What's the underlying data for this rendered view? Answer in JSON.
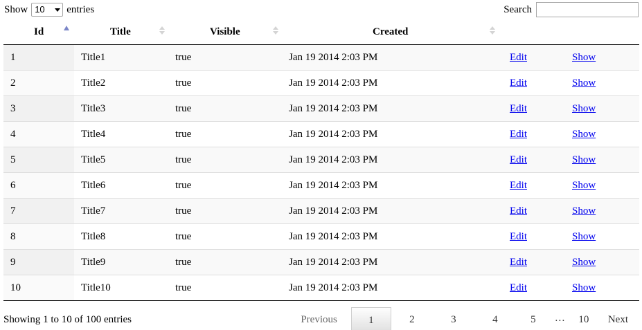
{
  "length_control": {
    "show_label": "Show",
    "selected": "10",
    "entries_label": "entries"
  },
  "search": {
    "label": "Search",
    "value": ""
  },
  "table": {
    "headers": {
      "id": "Id",
      "title": "Title",
      "visible": "Visible",
      "created": "Created"
    },
    "sorted_column": "id",
    "sort_direction": "ascending",
    "rows": [
      {
        "id": "1",
        "title": "Title1",
        "visible": "true",
        "created": "Jan 19 2014 2:03 PM",
        "edit": "Edit",
        "show": "Show"
      },
      {
        "id": "2",
        "title": "Title2",
        "visible": "true",
        "created": "Jan 19 2014 2:03 PM",
        "edit": "Edit",
        "show": "Show"
      },
      {
        "id": "3",
        "title": "Title3",
        "visible": "true",
        "created": "Jan 19 2014 2:03 PM",
        "edit": "Edit",
        "show": "Show"
      },
      {
        "id": "4",
        "title": "Title4",
        "visible": "true",
        "created": "Jan 19 2014 2:03 PM",
        "edit": "Edit",
        "show": "Show"
      },
      {
        "id": "5",
        "title": "Title5",
        "visible": "true",
        "created": "Jan 19 2014 2:03 PM",
        "edit": "Edit",
        "show": "Show"
      },
      {
        "id": "6",
        "title": "Title6",
        "visible": "true",
        "created": "Jan 19 2014 2:03 PM",
        "edit": "Edit",
        "show": "Show"
      },
      {
        "id": "7",
        "title": "Title7",
        "visible": "true",
        "created": "Jan 19 2014 2:03 PM",
        "edit": "Edit",
        "show": "Show"
      },
      {
        "id": "8",
        "title": "Title8",
        "visible": "true",
        "created": "Jan 19 2014 2:03 PM",
        "edit": "Edit",
        "show": "Show"
      },
      {
        "id": "9",
        "title": "Title9",
        "visible": "true",
        "created": "Jan 19 2014 2:03 PM",
        "edit": "Edit",
        "show": "Show"
      },
      {
        "id": "10",
        "title": "Title10",
        "visible": "true",
        "created": "Jan 19 2014 2:03 PM",
        "edit": "Edit",
        "show": "Show"
      }
    ]
  },
  "footer": {
    "info": "Showing 1 to 10 of 100 entries",
    "pagination": {
      "previous": "Previous",
      "pages": [
        "1",
        "2",
        "3",
        "4",
        "5"
      ],
      "current": "1",
      "ellipsis": "…",
      "last": "10",
      "next": "Next"
    }
  },
  "colors": {
    "link": "#0000ee",
    "sort_active": "#7b86c8",
    "sort_inactive": "#d4d4d4",
    "row_stripe": "#f9f9f9"
  },
  "icons": {
    "sort_active": "sort-ascending-icon",
    "sort_inactive": "sort-both-icon",
    "select": "chevron-down-icon"
  }
}
